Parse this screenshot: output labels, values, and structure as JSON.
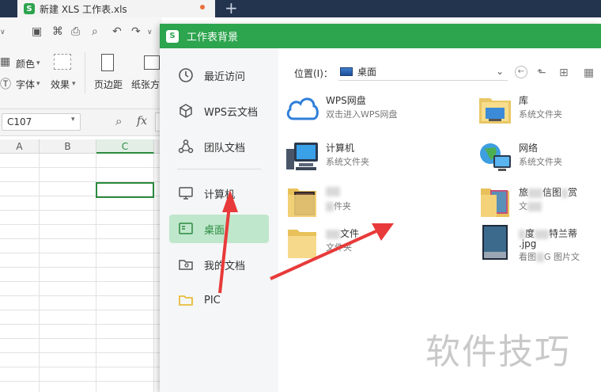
{
  "app": {
    "tab_title": "新建 XLS 工作表.xls",
    "plus": "+"
  },
  "toolbar": {
    "color_label": "颜色",
    "font_label": "字体",
    "effect_label": "效果",
    "margin_label": "页边距",
    "orientation_label": "纸张方"
  },
  "formula": {
    "cell_ref": "C107",
    "fx": "fx"
  },
  "sheet": {
    "columns": [
      "A",
      "B",
      "C"
    ]
  },
  "dialog": {
    "title": "工作表背景",
    "sidebar": [
      {
        "label": "最近访问",
        "icon": "clock-icon"
      },
      {
        "label": "WPS云文档",
        "icon": "cube-icon"
      },
      {
        "label": "团队文档",
        "icon": "team-icon"
      },
      {
        "label": "计算机",
        "icon": "monitor-icon"
      },
      {
        "label": "桌面",
        "icon": "desktop-icon"
      },
      {
        "label": "我的文档",
        "icon": "my-docs-icon"
      },
      {
        "label": "PIC",
        "icon": "folder-icon"
      }
    ],
    "location_label": "位置(I)：",
    "location_value": "桌面",
    "files": [
      {
        "name": "WPS网盘",
        "sub": "双击进入WPS网盘",
        "icon": "cloud-icon"
      },
      {
        "name": "库",
        "sub": "系统文件夹",
        "icon": "library-folder-icon"
      },
      {
        "name": "计算机",
        "sub": "系统文件夹",
        "icon": "computer-icon"
      },
      {
        "name": "网络",
        "sub": "系统文件夹",
        "icon": "network-icon"
      },
      {
        "name": "",
        "sub": "件夹",
        "icon": "photo-folder-icon"
      },
      {
        "name": "旅",
        "name_tail": "信图",
        "name_tail2": "赏",
        "sub": "文",
        "icon": "photo-folder-icon"
      },
      {
        "name": "",
        "name_tail": "文件",
        "sub": "文件夹",
        "icon": "folder-icon"
      },
      {
        "name": "度",
        "name_tail": "特兰蒂",
        "name_line2": ".jpg",
        "sub": "看图",
        "sub_tail": "G 图片文",
        "icon": "image-file-icon"
      }
    ]
  },
  "watermark": "软件技巧",
  "colors": {
    "accent": "#2da44e",
    "arrow": "#e83a3a",
    "active_bg": "#bfe7cc"
  }
}
